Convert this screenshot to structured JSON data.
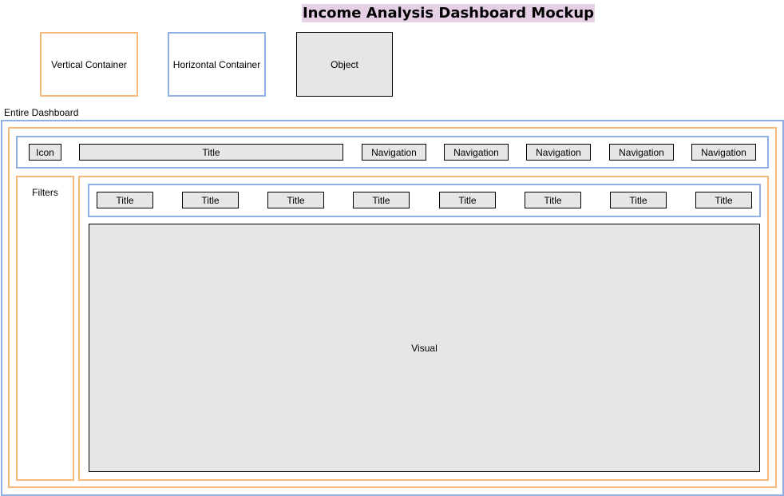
{
  "title": "Income Analysis Dashboard Mockup",
  "legend": {
    "vertical": "Vertical Container",
    "horizontal": "Horizontal Container",
    "object": "Object"
  },
  "dashboard_label": "Entire Dashboard",
  "header": {
    "icon": "Icon",
    "title": "Title",
    "navigation": [
      "Navigation",
      "Navigation",
      "Navigation",
      "Navigation",
      "Navigation"
    ]
  },
  "filters_label": "Filters",
  "tabs": [
    "Title",
    "Title",
    "Title",
    "Title",
    "Title",
    "Title",
    "Title",
    "Title"
  ],
  "visual_label": "Visual",
  "colors": {
    "vertical_container": "#f5b97d",
    "horizontal_container": "#8fb0e2",
    "object_fill": "#e6e6e6",
    "title_highlight": "#e6d0e6"
  }
}
